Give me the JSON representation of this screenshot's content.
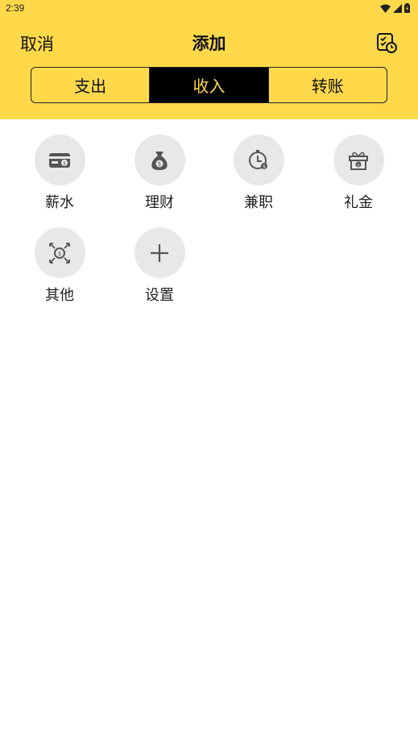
{
  "status_bar": {
    "time": "2:39"
  },
  "header": {
    "cancel_label": "取消",
    "title": "添加",
    "history_icon": "calendar-clock-icon"
  },
  "tabs": [
    {
      "label": "支出",
      "active": false
    },
    {
      "label": "收入",
      "active": true
    },
    {
      "label": "转账",
      "active": false
    }
  ],
  "categories": [
    {
      "label": "薪水",
      "icon": "salary-card-icon"
    },
    {
      "label": "理财",
      "icon": "money-bag-icon"
    },
    {
      "label": "兼职",
      "icon": "parttime-clock-icon"
    },
    {
      "label": "礼金",
      "icon": "gift-icon"
    },
    {
      "label": "其他",
      "icon": "other-coin-icon"
    },
    {
      "label": "设置",
      "icon": "plus-icon"
    }
  ],
  "colors": {
    "accent": "#FFD94A",
    "active_tab_bg": "#000000",
    "icon_circle": "#E8E8E8",
    "icon": "#555555"
  }
}
